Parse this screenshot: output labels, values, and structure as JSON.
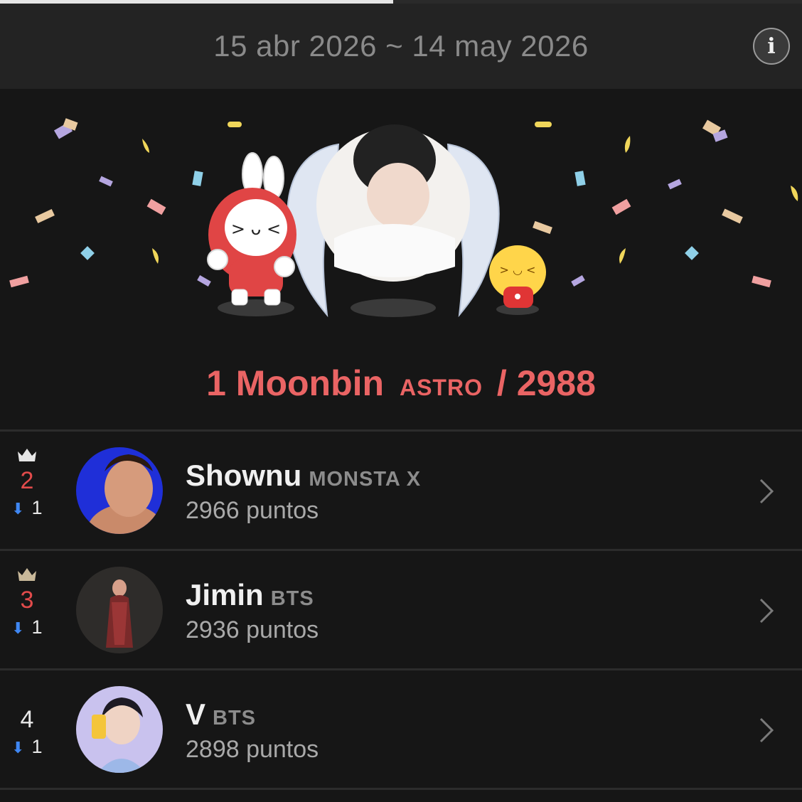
{
  "period": {
    "label": "15 abr 2026 ~ 14 may 2026",
    "progress": 0.49
  },
  "info_button": {
    "label": "i"
  },
  "winner": {
    "rank": "1",
    "name": "Moonbin",
    "group": "ASTRO",
    "separator": "/",
    "score": "2988"
  },
  "ranking": [
    {
      "rank": "2",
      "rank_color": "red",
      "crown": true,
      "change": "1",
      "change_direction": "down",
      "name": "Shownu",
      "group": "MONSTA X",
      "points": "2966 puntos"
    },
    {
      "rank": "3",
      "rank_color": "red",
      "crown": true,
      "change": "1",
      "change_direction": "down",
      "name": "Jimin",
      "group": "BTS",
      "points": "2936 puntos"
    },
    {
      "rank": "4",
      "rank_color": "white",
      "crown": false,
      "change": "1",
      "change_direction": "down",
      "name": "V",
      "group": "BTS",
      "points": "2898 puntos"
    }
  ],
  "colors": {
    "accent": "#ea6464",
    "rank_red": "#e24b4b",
    "down_arrow": "#3f87f3"
  }
}
